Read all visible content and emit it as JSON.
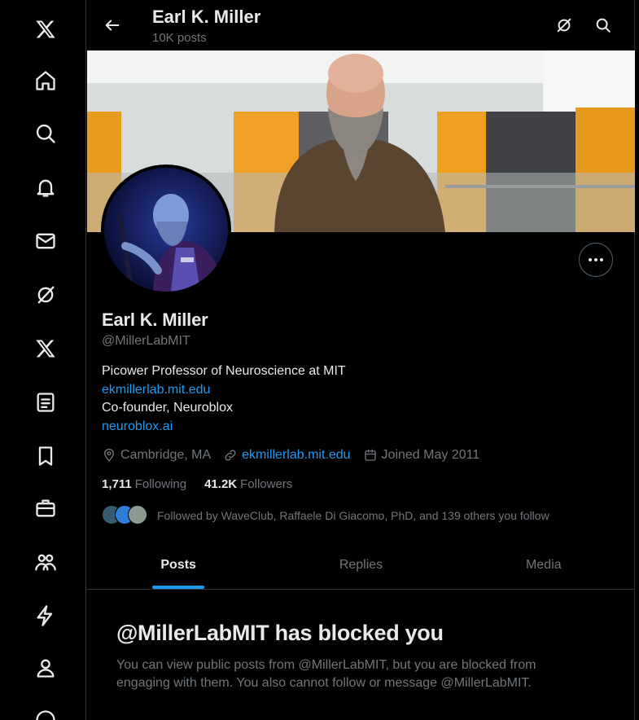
{
  "nav": {
    "items": [
      {
        "name": "x-logo-icon"
      },
      {
        "name": "home-icon"
      },
      {
        "name": "search-icon"
      },
      {
        "name": "notifications-icon"
      },
      {
        "name": "messages-icon"
      },
      {
        "name": "grok-icon"
      },
      {
        "name": "premium-x-icon"
      },
      {
        "name": "lists-icon"
      },
      {
        "name": "bookmarks-icon"
      },
      {
        "name": "jobs-icon"
      },
      {
        "name": "communities-icon"
      },
      {
        "name": "verified-orgs-icon"
      },
      {
        "name": "profile-icon"
      },
      {
        "name": "more-icon"
      }
    ]
  },
  "header": {
    "name": "Earl K. Miller",
    "posts": "10K posts"
  },
  "profile": {
    "name": "Earl K. Miller",
    "handle": "@MillerLabMIT",
    "bio_line1": "Picower Professor of Neuroscience at MIT",
    "bio_link1": "ekmillerlab.mit.edu",
    "bio_line2": "Co-founder, Neuroblox",
    "bio_link2": "neuroblox.ai",
    "location": "Cambridge, MA",
    "website": "ekmillerlab.mit.edu",
    "joined": "Joined May 2011",
    "following_count": "1,711",
    "following_label": "Following",
    "followers_count": "41.2K",
    "followers_label": "Followers",
    "followed_by": "Followed by WaveClub, Raffaele Di Giacomo, PhD, and 139 others you follow"
  },
  "tabs": [
    {
      "label": "Posts",
      "active": true
    },
    {
      "label": "Replies",
      "active": false
    },
    {
      "label": "Media",
      "active": false
    }
  ],
  "blocked": {
    "title": "@MillerLabMIT has blocked you",
    "text": "You can view public posts from @MillerLabMIT, but you are blocked from engaging with them. You also cannot follow or message @MillerLabMIT."
  },
  "colors": {
    "background": "#000000",
    "text": "#e7e9ea",
    "muted": "#71767b",
    "accent": "#1d9bf0",
    "border": "#2f3336"
  }
}
